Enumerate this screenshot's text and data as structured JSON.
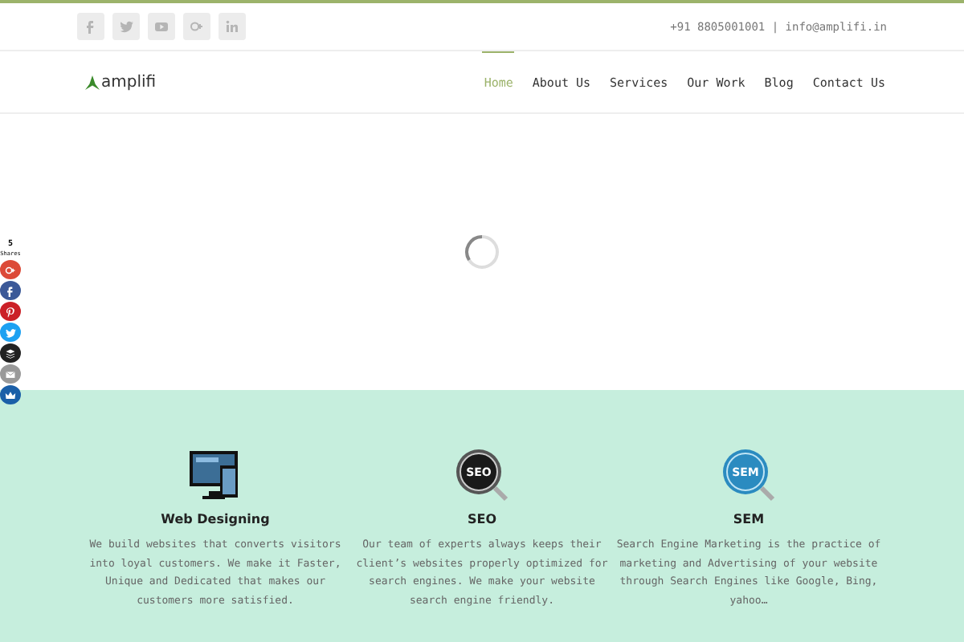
{
  "top_bar": {
    "social": [
      {
        "kind": "facebook"
      },
      {
        "kind": "twitter"
      },
      {
        "kind": "youtube"
      },
      {
        "kind": "googleplus"
      },
      {
        "kind": "linkedin"
      }
    ],
    "contact": "+91 8805001001 | info@amplifi.in"
  },
  "header": {
    "logo": "amplifi",
    "nav": [
      {
        "label": "Home",
        "selected": true
      },
      {
        "label": "About Us",
        "selected": false
      },
      {
        "label": "Services",
        "selected": false
      },
      {
        "label": "Our Work",
        "selected": false
      },
      {
        "label": "Blog",
        "selected": false
      },
      {
        "label": "Contact Us",
        "selected": false
      }
    ]
  },
  "share_bar": {
    "count": "5",
    "label": "Shares",
    "buttons": [
      {
        "kind": "googleplus",
        "color": "#dc4a38"
      },
      {
        "kind": "facebook",
        "color": "#3b5998"
      },
      {
        "kind": "pinterest",
        "color": "#cb2027"
      },
      {
        "kind": "twitter",
        "color": "#1da1f2"
      },
      {
        "kind": "buffer",
        "color": "#222222"
      },
      {
        "kind": "email",
        "color": "#999999"
      },
      {
        "kind": "crown",
        "color": "#1a5fa8"
      }
    ]
  },
  "services": [
    {
      "kind": "monitor",
      "title": "Web Designing",
      "text": "We build websites that converts visitors into loyal customers. We make it Faster, Unique and Dedicated that makes our customers more satisfied."
    },
    {
      "kind": "seo",
      "icon_text": "SEO",
      "title": "SEO",
      "text": "Our team of experts always keeps their client’s websites properly optimized for search engines. We make your website search engine friendly."
    },
    {
      "kind": "sem",
      "icon_text": "SEM",
      "title": "SEM",
      "text": "Search Engine Marketing is the practice of marketing and Advertising of your website through Search Engines like Google, Bing, yahoo…"
    }
  ]
}
